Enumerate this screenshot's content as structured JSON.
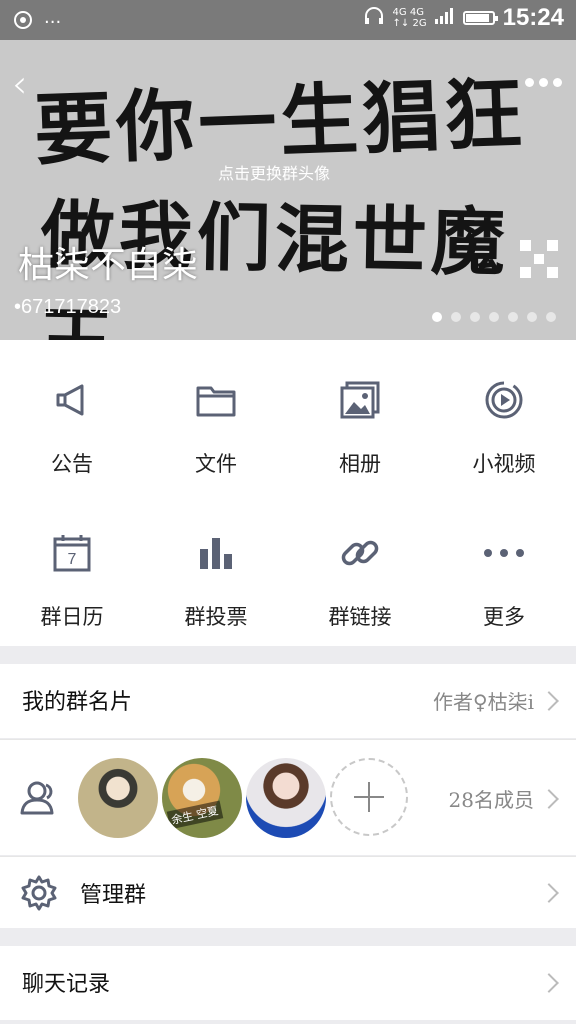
{
  "status_bar": {
    "network": "4G 4G\n↑↓ 2G",
    "time": "15:24",
    "battery_level": 0.85
  },
  "banner": {
    "calligraphy_line1": "要你一生猖狂",
    "calligraphy_line2": "做我们混世魔王",
    "change_avatar_hint": "点击更换群头像",
    "group_name": "枯柒不自柒",
    "group_id": "•671717823",
    "page_count": 7,
    "current_page": 1
  },
  "features": [
    {
      "label": "公告",
      "icon": "announcement-icon"
    },
    {
      "label": "文件",
      "icon": "folder-icon"
    },
    {
      "label": "相册",
      "icon": "album-icon"
    },
    {
      "label": "小视频",
      "icon": "video-icon"
    },
    {
      "label": "群日历",
      "icon": "calendar-icon"
    },
    {
      "label": "群投票",
      "icon": "vote-icon"
    },
    {
      "label": "群链接",
      "icon": "link-icon"
    },
    {
      "label": "更多",
      "icon": "more-icon"
    }
  ],
  "calendar_day": "7",
  "my_card": {
    "label": "我的群名片",
    "value": "作者♀枯柒i"
  },
  "members": {
    "count_text": "28名成员",
    "avatar2_tag": "余生 空夏"
  },
  "manage": {
    "label": "管理群"
  },
  "chat_history": {
    "label": "聊天记录"
  },
  "colors": {
    "icon": "#5b6275",
    "chevron": "#bbbbbb"
  }
}
